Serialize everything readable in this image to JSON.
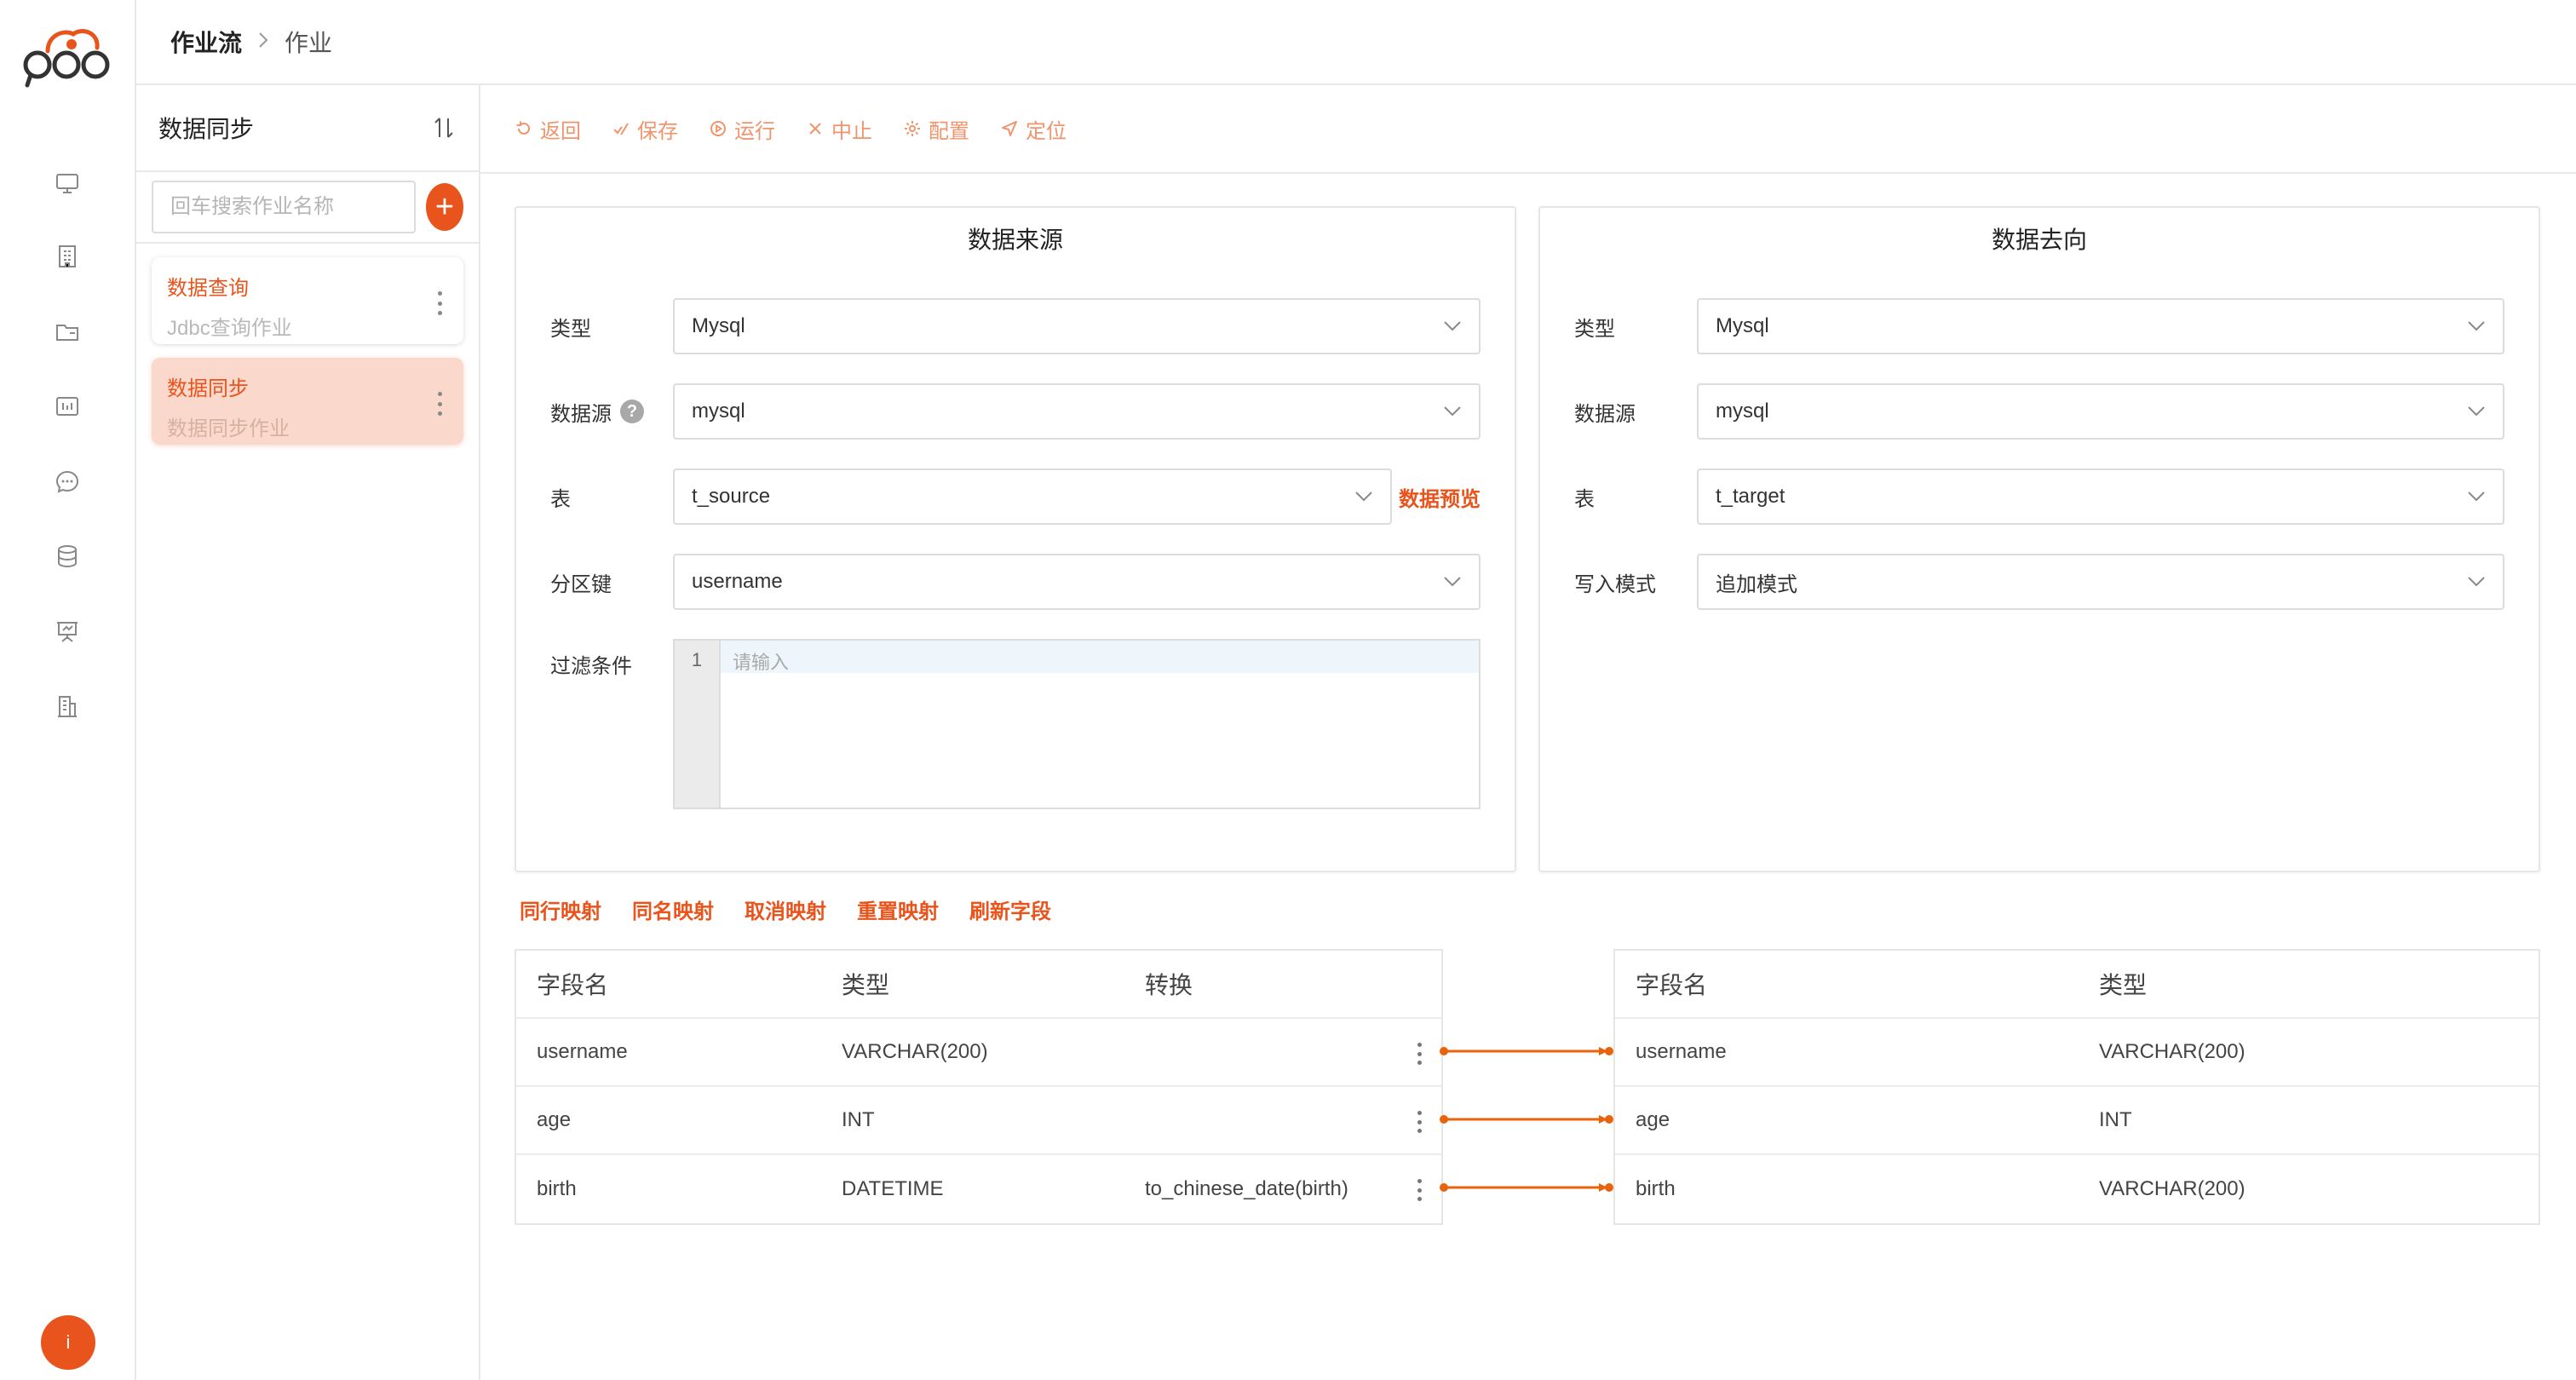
{
  "nav": {
    "icons": [
      "monitor-icon",
      "building-icon",
      "folder-icon",
      "dashboard-icon",
      "chat-icon",
      "database-icon",
      "presentation-icon",
      "office-icon"
    ],
    "user_initial": "i",
    "accent": "#e8541c"
  },
  "breadcrumb": {
    "root": "作业流",
    "separator": ">",
    "current": "作业"
  },
  "jobs": {
    "title": "数据同步",
    "search_placeholder": "回车搜索作业名称",
    "add_label": "+",
    "items": [
      {
        "name": "数据查询",
        "desc": "Jdbc查询作业",
        "active": false
      },
      {
        "name": "数据同步",
        "desc": "数据同步作业",
        "active": true
      }
    ]
  },
  "toolbar": {
    "back": "返回",
    "save": "保存",
    "run": "运行",
    "stop": "中止",
    "config": "配置",
    "locate": "定位"
  },
  "source": {
    "title": "数据来源",
    "type_label": "类型",
    "type_value": "Mysql",
    "datasource_label": "数据源",
    "datasource_help": "?",
    "datasource_value": "mysql",
    "table_label": "表",
    "table_value": "t_source",
    "preview_link": "数据预览",
    "partition_label": "分区键",
    "partition_value": "username",
    "filter_label": "过滤条件",
    "filter_line_number": "1",
    "filter_placeholder": "请输入"
  },
  "target": {
    "title": "数据去向",
    "type_label": "类型",
    "type_value": "Mysql",
    "datasource_label": "数据源",
    "datasource_value": "mysql",
    "table_label": "表",
    "table_value": "t_target",
    "write_mode_label": "写入模式",
    "write_mode_value": "追加模式"
  },
  "mapping_actions": [
    "同行映射",
    "同名映射",
    "取消映射",
    "重置映射",
    "刷新字段"
  ],
  "source_fields": {
    "headers": [
      "字段名",
      "类型",
      "转换"
    ],
    "rows": [
      [
        "username",
        "VARCHAR(200)",
        ""
      ],
      [
        "age",
        "INT",
        ""
      ],
      [
        "birth",
        "DATETIME",
        "to_chinese_date(birth)"
      ]
    ]
  },
  "target_fields": {
    "headers": [
      "字段名",
      "类型"
    ],
    "rows": [
      [
        "username",
        "VARCHAR(200)"
      ],
      [
        "age",
        "INT"
      ],
      [
        "birth",
        "VARCHAR(200)"
      ]
    ]
  }
}
